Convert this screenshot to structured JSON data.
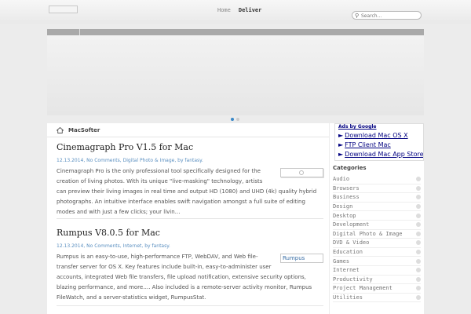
{
  "nav": {
    "items": [
      {
        "label": "Home"
      },
      {
        "label": "Deliver"
      }
    ]
  },
  "search": {
    "placeholder": "Search..."
  },
  "breadcrumb": {
    "title": "MacSofter"
  },
  "posts": [
    {
      "title": "Cinemagraph Pro V1.5 for Mac",
      "meta": "12.13.2014, No Comments, Digital Photo & Image, by fantasy.",
      "excerpt": "Cinemagraph Pro is the only professional tool specifically designed for the creation of living photos. With its unique \"live-masking\" technology, artists can preview their living images in real time and output HD (1080) and UHD (4k) quality hybrid photographs. An intuitive interface enables swift navigation amongst a full suite of editing modes and with just a few clicks; your livin…"
    },
    {
      "title": "Rumpus V8.0.5 for Mac",
      "meta": "12.13.2014, No Comments, Internet, by fantasy.",
      "thumb_label": "Rumpus",
      "excerpt": "Rumpus is an easy-to-use, high-performance FTP, WebDAV, and Web file-transfer server for OS X. Key features include built-in, easy-to-administer user accounts, integrated Web file transfers, file upload notification, extensive security options, blazing performance, and more…. Also included is a remote-server activity monitor, Rumpus FileWatch, and a server-statistics widget, RumpusStat."
    }
  ],
  "ads": {
    "title": "Ads by Google",
    "links": [
      {
        "label": "Download Mac OS X"
      },
      {
        "label": "FTP Client Mac"
      },
      {
        "label": "Download Mac App Store"
      }
    ]
  },
  "categories": {
    "title": "Categories",
    "items": [
      "Audio",
      "Browsers",
      "Business",
      "Design",
      "Desktop",
      "Development",
      "Digital Photo & Image",
      "DVD & Video",
      "Education",
      "Games",
      "Internet",
      "Productivity",
      "Project Management",
      "Utilities"
    ]
  },
  "colors": {
    "accent": "#3a88c8",
    "link": "#5a8fc0",
    "ads": "#000080"
  }
}
